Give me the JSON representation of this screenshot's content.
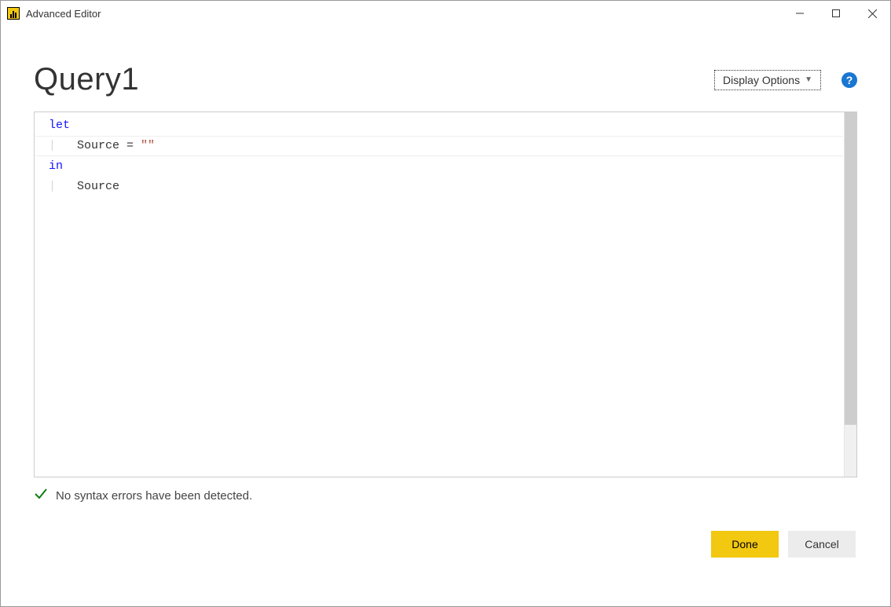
{
  "titlebar": {
    "title": "Advanced Editor"
  },
  "header": {
    "query_name": "Query1",
    "display_options_label": "Display Options"
  },
  "editor": {
    "code": {
      "line1_kw": "let",
      "line2_text": "Source = ",
      "line2_str": "\"\"",
      "line3_kw": "in",
      "line4_text": "Source"
    }
  },
  "status": {
    "message": "No syntax errors have been detected."
  },
  "footer": {
    "done_label": "Done",
    "cancel_label": "Cancel"
  }
}
